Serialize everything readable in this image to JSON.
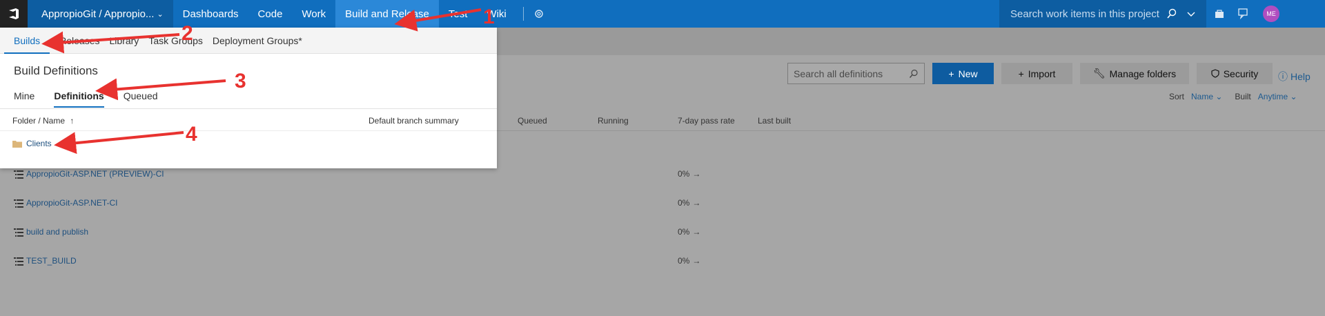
{
  "topbar": {
    "project": "AppropioGit / Appropio...",
    "nav": [
      "Dashboards",
      "Code",
      "Work",
      "Build and Release",
      "Test",
      "Wiki"
    ],
    "search_placeholder": "Search work items in this project",
    "avatar_initials": "ME"
  },
  "subnav": {
    "items": [
      "Builds",
      "Releases",
      "Library",
      "Task Groups",
      "Deployment Groups*"
    ]
  },
  "page": {
    "title": "Build Definitions",
    "tabs": [
      "Mine",
      "Definitions",
      "Queued"
    ]
  },
  "toolbar": {
    "search_placeholder": "Search all definitions",
    "new": "New",
    "import": "Import",
    "manage_folders": "Manage folders",
    "security": "Security",
    "help": "Help"
  },
  "sort": {
    "sort_label": "Sort",
    "sort_value": "Name",
    "built_label": "Built",
    "built_value": "Anytime"
  },
  "table": {
    "columns": [
      "Folder / Name",
      "Default branch summary",
      "Queued",
      "Running",
      "7-day pass rate",
      "Last built"
    ],
    "folder": "Clients",
    "rows": [
      {
        "name": "AppropioGit-ASP.NET (PREVIEW)-CI",
        "rate": "0%"
      },
      {
        "name": "AppropioGit-ASP.NET-CI",
        "rate": "0%"
      },
      {
        "name": "build and publish",
        "rate": "0%"
      },
      {
        "name": "TEST_BUILD",
        "rate": "0%"
      }
    ]
  },
  "annotations": [
    "1",
    "2",
    "3",
    "4"
  ],
  "colors": {
    "accent": "#106ebe",
    "arrow": "#e8322f"
  }
}
